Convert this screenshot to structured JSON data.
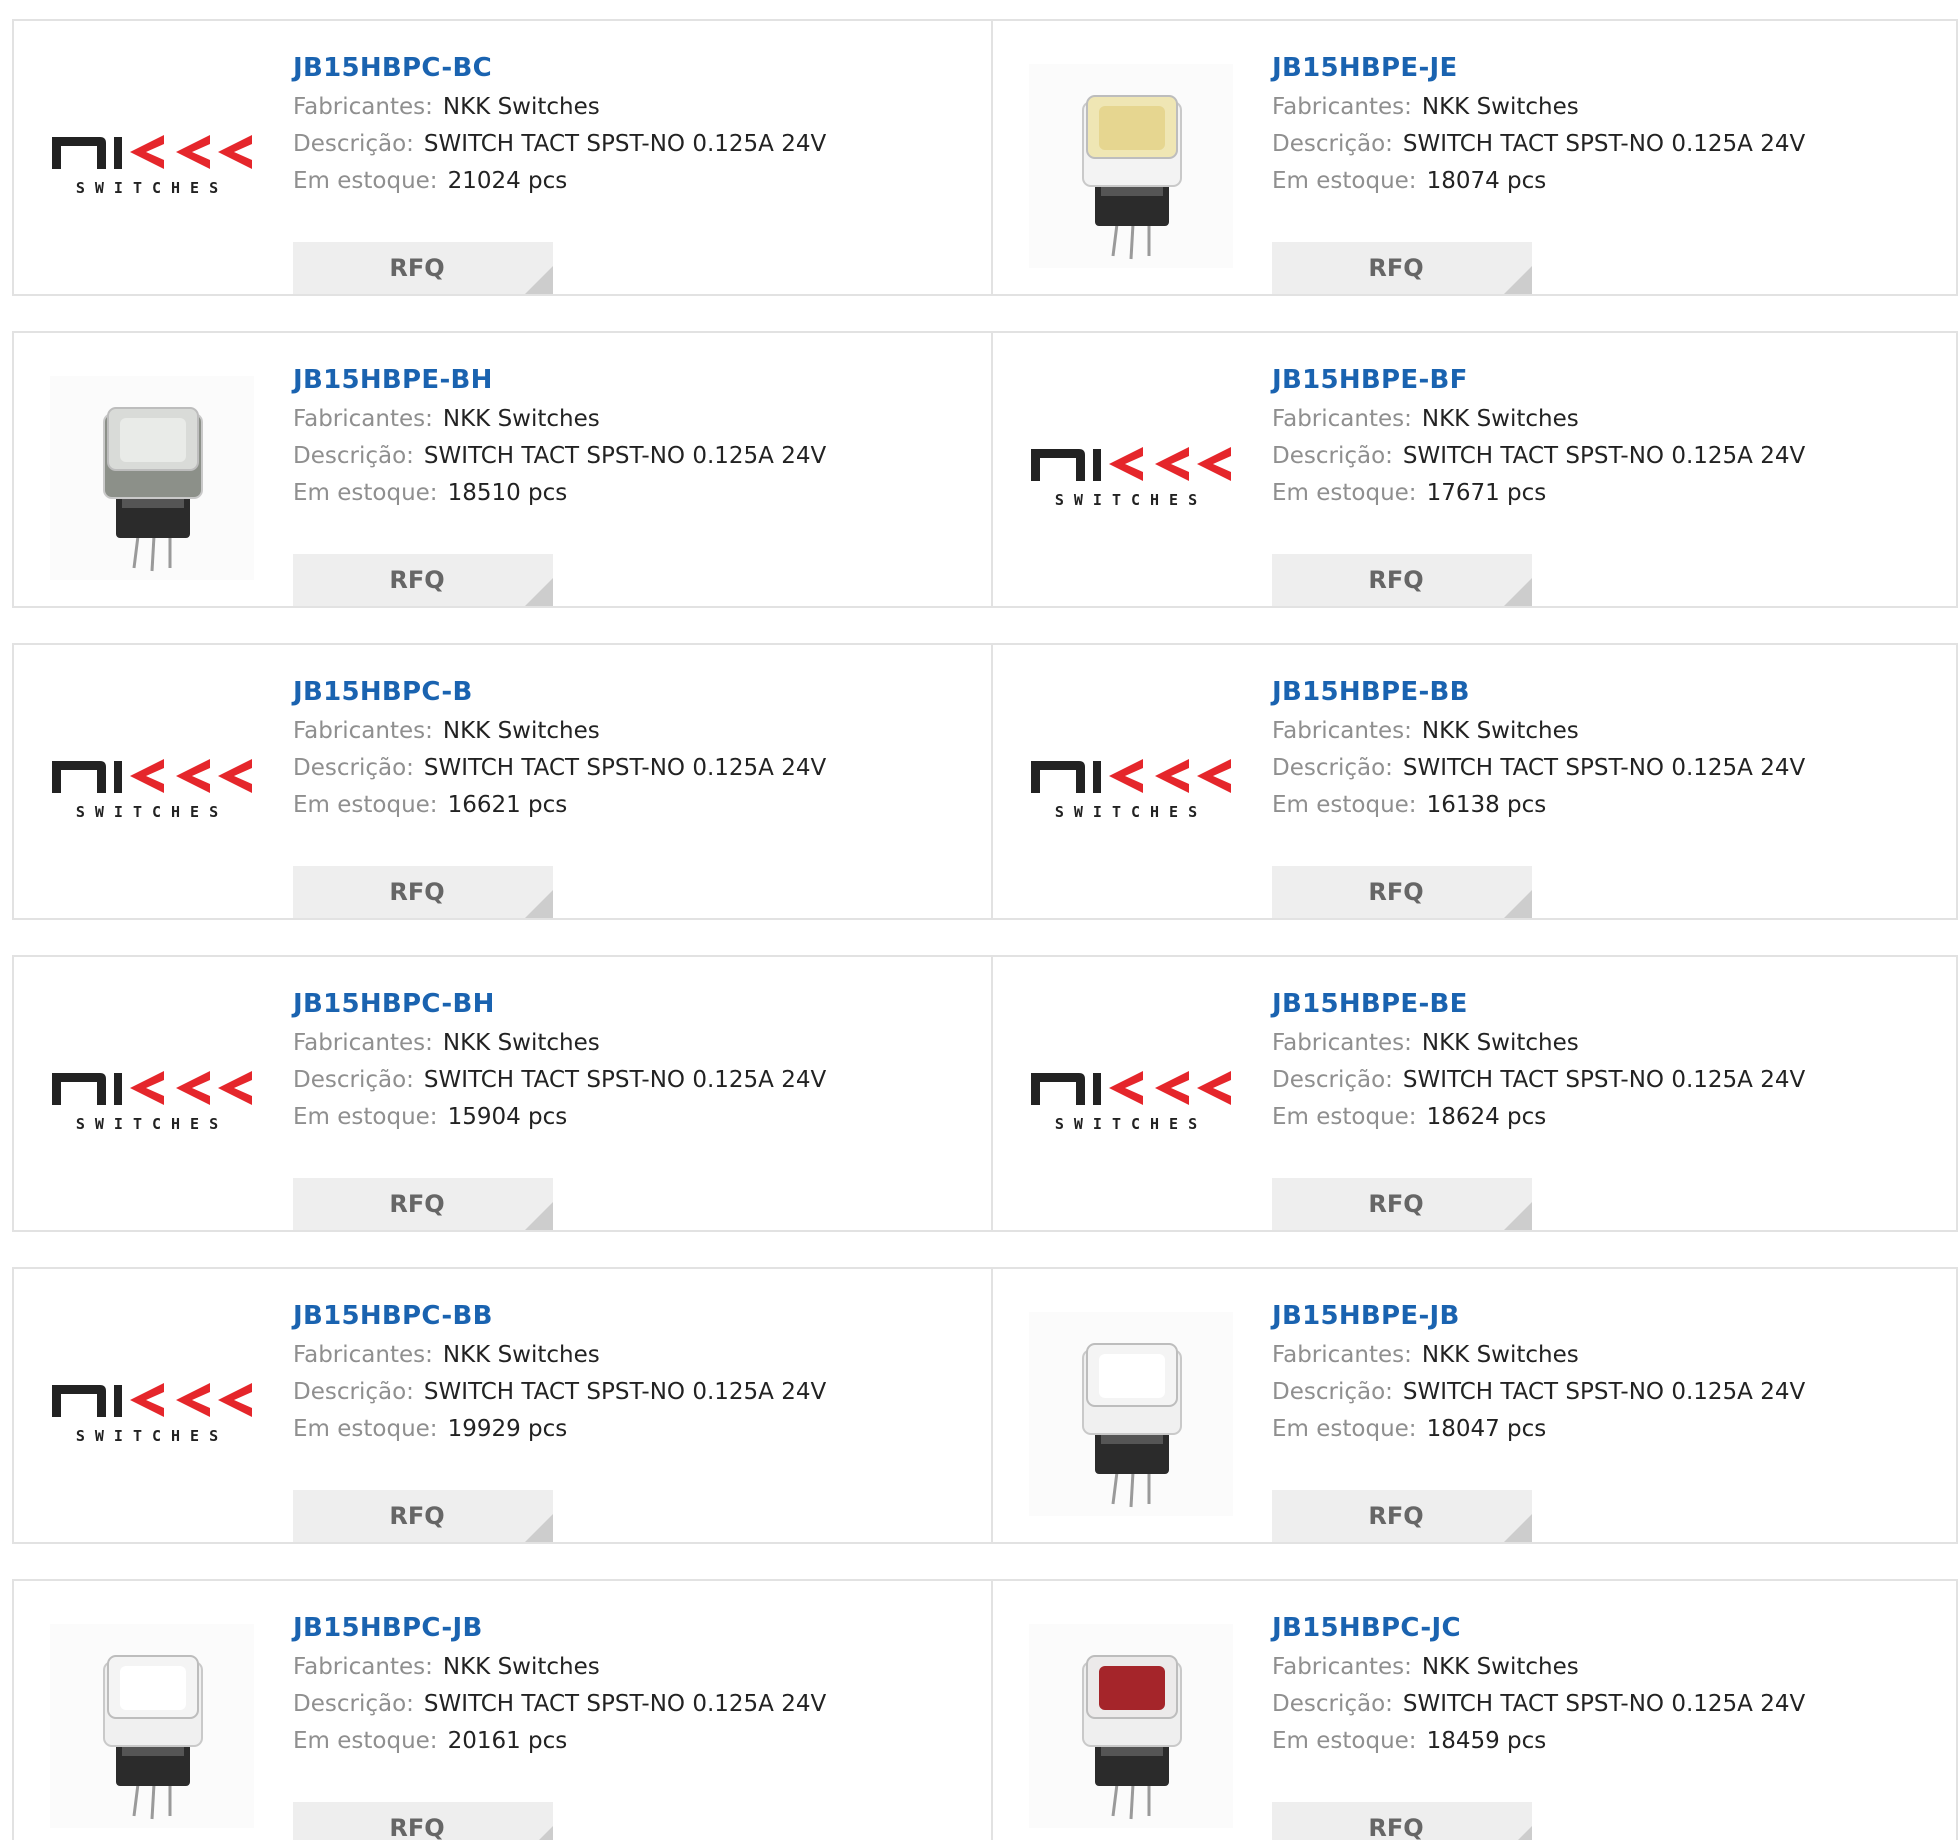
{
  "labels": {
    "manufacturer": "Fabricantes:",
    "description": "Descrição:",
    "stock": "Em estoque:",
    "rfq": "RFQ"
  },
  "logo": {
    "top": "nikk",
    "bottom": "SWITCHES"
  },
  "products": [
    {
      "part": "JB15HBPC-BC",
      "manufacturer": "NKK Switches",
      "description": "SWITCH TACT SPST-NO 0.125A 24V",
      "stock": "21024 pcs",
      "image": "nkk-logo"
    },
    {
      "part": "JB15HBPE-JE",
      "manufacturer": "NKK Switches",
      "description": "SWITCH TACT SPST-NO 0.125A 24V",
      "stock": "18074 pcs",
      "image": "switch-yellow"
    },
    {
      "part": "JB15HBPE-BH",
      "manufacturer": "NKK Switches",
      "description": "SWITCH TACT SPST-NO 0.125A 24V",
      "stock": "18510 pcs",
      "image": "switch-gray"
    },
    {
      "part": "JB15HBPE-BF",
      "manufacturer": "NKK Switches",
      "description": "SWITCH TACT SPST-NO 0.125A 24V",
      "stock": "17671 pcs",
      "image": "nkk-logo"
    },
    {
      "part": "JB15HBPC-B",
      "manufacturer": "NKK Switches",
      "description": "SWITCH TACT SPST-NO 0.125A 24V",
      "stock": "16621 pcs",
      "image": "nkk-logo"
    },
    {
      "part": "JB15HBPE-BB",
      "manufacturer": "NKK Switches",
      "description": "SWITCH TACT SPST-NO 0.125A 24V",
      "stock": "16138 pcs",
      "image": "nkk-logo"
    },
    {
      "part": "JB15HBPC-BH",
      "manufacturer": "NKK Switches",
      "description": "SWITCH TACT SPST-NO 0.125A 24V",
      "stock": "15904 pcs",
      "image": "nkk-logo"
    },
    {
      "part": "JB15HBPE-BE",
      "manufacturer": "NKK Switches",
      "description": "SWITCH TACT SPST-NO 0.125A 24V",
      "stock": "18624 pcs",
      "image": "nkk-logo"
    },
    {
      "part": "JB15HBPC-BB",
      "manufacturer": "NKK Switches",
      "description": "SWITCH TACT SPST-NO 0.125A 24V",
      "stock": "19929 pcs",
      "image": "nkk-logo"
    },
    {
      "part": "JB15HBPE-JB",
      "manufacturer": "NKK Switches",
      "description": "SWITCH TACT SPST-NO 0.125A 24V",
      "stock": "18047 pcs",
      "image": "switch-clear"
    },
    {
      "part": "JB15HBPC-JB",
      "manufacturer": "NKK Switches",
      "description": "SWITCH TACT SPST-NO 0.125A 24V",
      "stock": "20161 pcs",
      "image": "switch-clear"
    },
    {
      "part": "JB15HBPC-JC",
      "manufacturer": "NKK Switches",
      "description": "SWITCH TACT SPST-NO 0.125A 24V",
      "stock": "18459 pcs",
      "image": "switch-red"
    }
  ],
  "colors": {
    "part_link": "#1a63b0",
    "label": "#8f8f8f",
    "button_bg": "#eeeeee",
    "border": "#e2e2e2"
  }
}
